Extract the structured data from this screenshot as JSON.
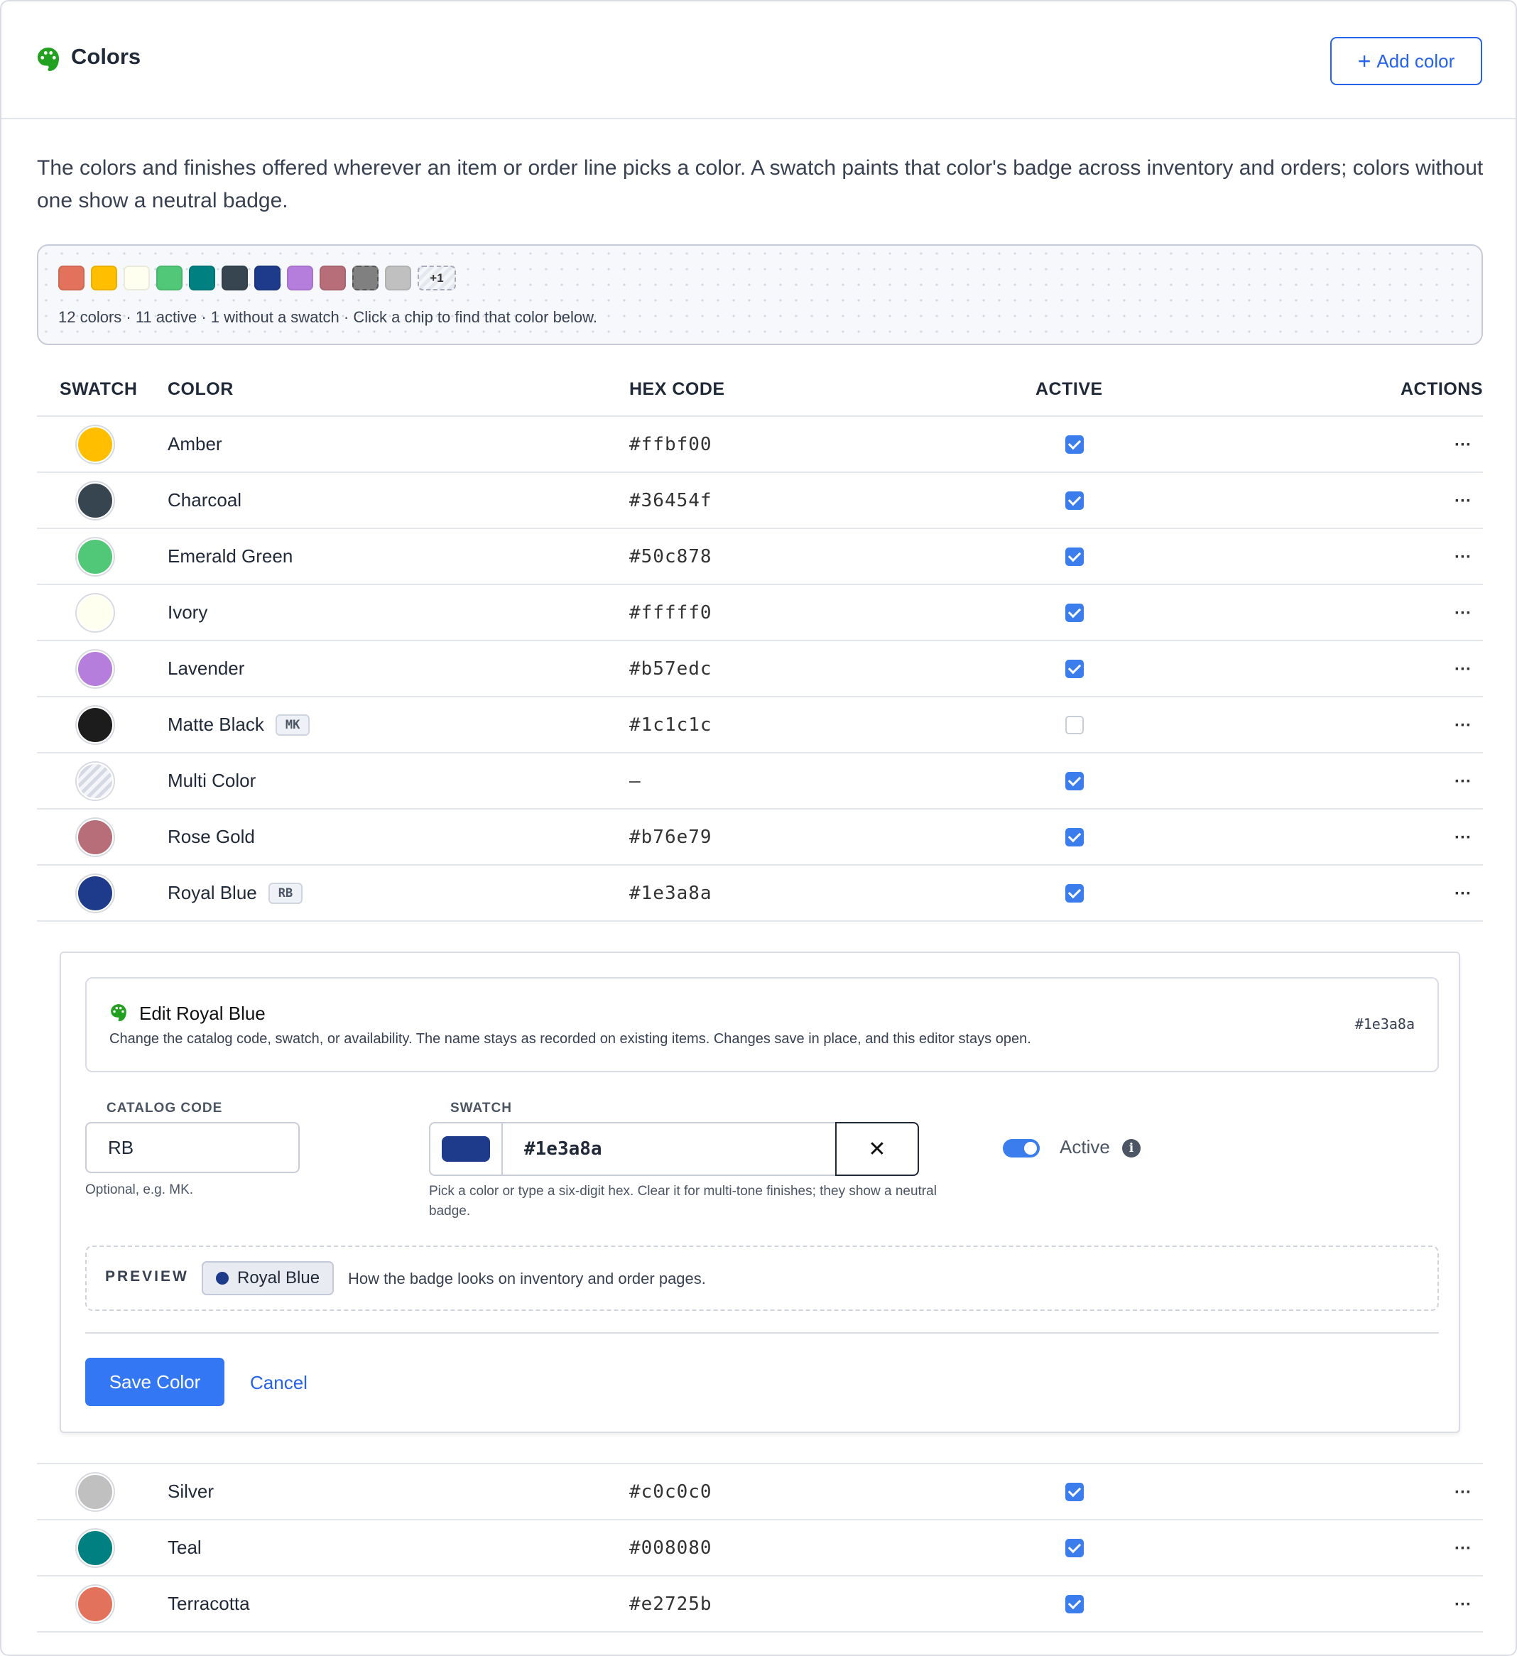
{
  "header": {
    "title": "Colors",
    "add_label": "Add color",
    "brand_color": "#2563eb",
    "palette_icon_color": "#22a020"
  },
  "description": "The colors and finishes offered wherever an item or order line picks a color. A swatch paints that color's badge across inventory and orders; colors without one show a neutral badge.",
  "strip": {
    "chips": [
      "#e2725b",
      "#ffbf00",
      "#fffff0",
      "#50c878",
      "#008080",
      "#36454f",
      "#1e3a8a",
      "#b57edc",
      "#b76e79",
      "#808080",
      "#c0c0c0"
    ],
    "more_label": "+1",
    "summary": "12 colors · 11 active · 1 without a swatch · Click a chip to find that color below."
  },
  "table": {
    "columns": [
      "SWATCH",
      "COLOR",
      "HEX CODE",
      "ACTIVE",
      "ACTIONS"
    ],
    "rows": [
      {
        "name": "Amber",
        "code": "",
        "hex": "#ffbf00",
        "swatch": "#ffbf00",
        "active": true
      },
      {
        "name": "Charcoal",
        "code": "",
        "hex": "#36454f",
        "swatch": "#36454f",
        "active": true
      },
      {
        "name": "Emerald Green",
        "code": "",
        "hex": "#50c878",
        "swatch": "#50c878",
        "active": true
      },
      {
        "name": "Ivory",
        "code": "",
        "hex": "#fffff0",
        "swatch": "#fffff0",
        "active": true
      },
      {
        "name": "Lavender",
        "code": "",
        "hex": "#b57edc",
        "swatch": "#b57edc",
        "active": true
      },
      {
        "name": "Matte Black",
        "code": "MK",
        "hex": "#1c1c1c",
        "swatch": "#1c1c1c",
        "active": false
      },
      {
        "name": "Multi Color",
        "code": "",
        "hex": "—",
        "swatch": "",
        "active": true
      },
      {
        "name": "Rose Gold",
        "code": "",
        "hex": "#b76e79",
        "swatch": "#b76e79",
        "active": true
      },
      {
        "name": "Royal Blue",
        "code": "RB",
        "hex": "#1e3a8a",
        "swatch": "#1e3a8a",
        "active": true
      },
      {
        "name": "Silver",
        "code": "",
        "hex": "#c0c0c0",
        "swatch": "#c0c0c0",
        "active": true
      },
      {
        "name": "Teal",
        "code": "",
        "hex": "#008080",
        "swatch": "#008080",
        "active": true
      },
      {
        "name": "Terracotta",
        "code": "",
        "hex": "#e2725b",
        "swatch": "#e2725b",
        "active": true
      }
    ],
    "actions_icon": "ellipsis-icon",
    "actions_label": "···"
  },
  "editor": {
    "title": "Edit Royal Blue",
    "subtitle": "Change the catalog code, swatch, or availability. The name stays as recorded on existing items. Changes save in place, and this editor stays open.",
    "hex_badge": "#1e3a8a",
    "catalog_code_label": "CATALOG CODE",
    "catalog_code_value": "RB",
    "catalog_code_help": "Optional, e.g. MK.",
    "swatch_label": "SWATCH",
    "swatch_color": "#1e3a8a",
    "swatch_value": "#1e3a8a",
    "clear_label": "✕",
    "swatch_help": "Pick a color or type a six-digit hex. Clear it for multi-tone finishes; they show a neutral badge.",
    "active_label": "Active",
    "active_on": true,
    "info_label": "i",
    "preview_label": "PREVIEW",
    "preview_badge": "Royal Blue",
    "preview_note": "How the badge looks on inventory and order pages.",
    "save_label": "Save Color",
    "cancel_label": "Cancel"
  }
}
